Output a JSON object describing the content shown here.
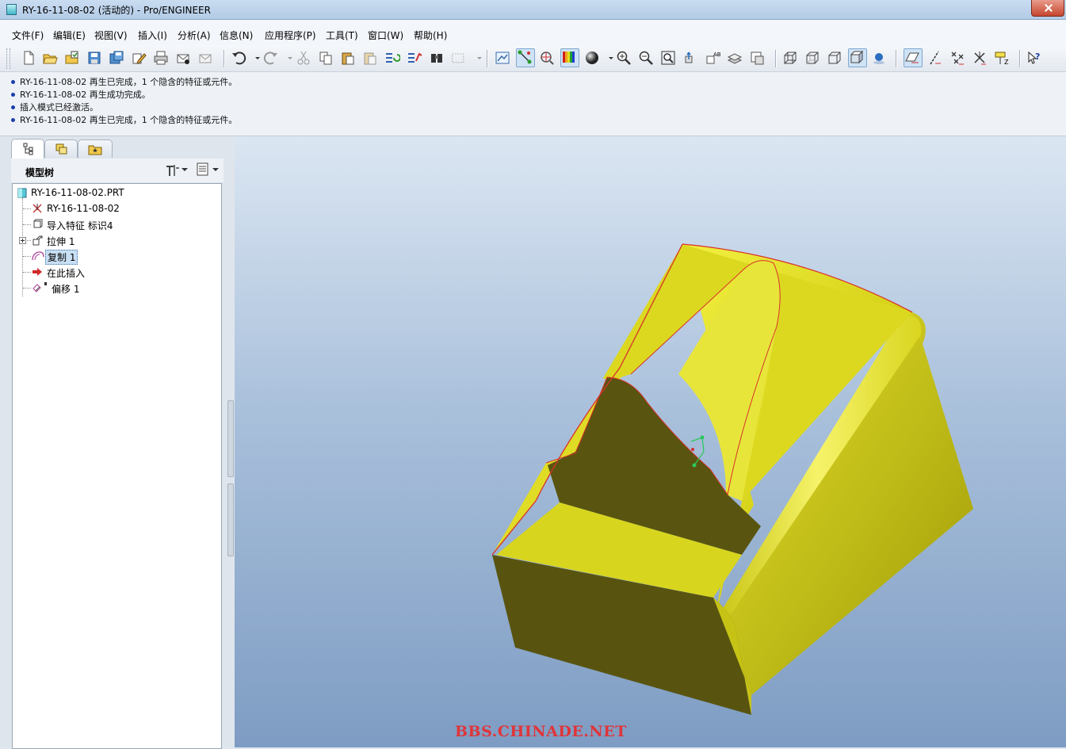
{
  "window": {
    "title": "RY-16-11-08-02 (活动的) - Pro/ENGINEER"
  },
  "menu": [
    {
      "label": "文件(F)"
    },
    {
      "label": "编辑(E)"
    },
    {
      "label": "视图(V)"
    },
    {
      "label": "插入(I)"
    },
    {
      "label": "分析(A)"
    },
    {
      "label": "信息(N)"
    },
    {
      "label": "应用程序(P)"
    },
    {
      "label": "工具(T)"
    },
    {
      "label": "窗口(W)"
    },
    {
      "label": "帮助(H)"
    }
  ],
  "toolbar": {
    "icons": [
      "new-file-icon",
      "open-folder-icon",
      "open-session-icon",
      "save-icon",
      "save-copy-icon",
      "rename-icon",
      "print-icon",
      "mail-icon",
      "mail-link-icon",
      "undo-icon",
      "redo-icon",
      "cut-icon",
      "copy-icon",
      "paste-icon",
      "paste-special-icon",
      "regenerate-icon",
      "regen-manager-icon",
      "find-icon",
      "select-box-icon",
      "sketcher-display-icon",
      "datum-display-icon",
      "spin-center-icon",
      "color-appearance-icon",
      "shading-sphere-icon",
      "zoom-in-icon",
      "zoom-out-icon",
      "refit-icon",
      "reorient-icon",
      "saved-views-icon",
      "layers-icon",
      "view-manager-icon",
      "wireframe-icon",
      "hidden-line-icon",
      "no-hidden-icon",
      "shading-icon",
      "enhanced-realism-icon",
      "datum-planes-icon",
      "datum-axes-icon",
      "datum-points-icon",
      "csys-icon",
      "annotation-icon",
      "whats-this-icon"
    ]
  },
  "messages": [
    "RY-16-11-08-02 再生已完成，1 个隐含的特征或元件。",
    "RY-16-11-08-02 再生成功完成。",
    "插入模式已经激活。",
    "RY-16-11-08-02 再生已完成，1 个隐含的特征或元件。"
  ],
  "navigator": {
    "tabs": [
      "model-tree-tab-icon",
      "folder-browser-tab-icon",
      "favorites-tab-icon"
    ],
    "title": "模型树"
  },
  "tree": {
    "root": "RY-16-11-08-02.PRT",
    "items": [
      {
        "label": "RY-16-11-08-02",
        "icon": "csys-feature-icon"
      },
      {
        "label": "导入特征 标识4",
        "icon": "import-feature-icon"
      },
      {
        "label": "拉伸 1",
        "icon": "extrude-feature-icon"
      },
      {
        "label": "复制 1",
        "icon": "copy-surface-icon"
      },
      {
        "label": "在此插入",
        "icon": "insert-here-arrow-icon"
      },
      {
        "label": "偏移 1",
        "icon": "offset-feature-icon"
      }
    ]
  },
  "colors": {
    "model_face_light": "#e3e02a",
    "model_face_mid": "#c8c412",
    "model_face_dark": "#595510",
    "edge_highlight": "#d8312a",
    "background_top": "#dbe6f2",
    "background_bottom": "#7e9cc3"
  },
  "watermark": "BBS.CHINADE.NET"
}
